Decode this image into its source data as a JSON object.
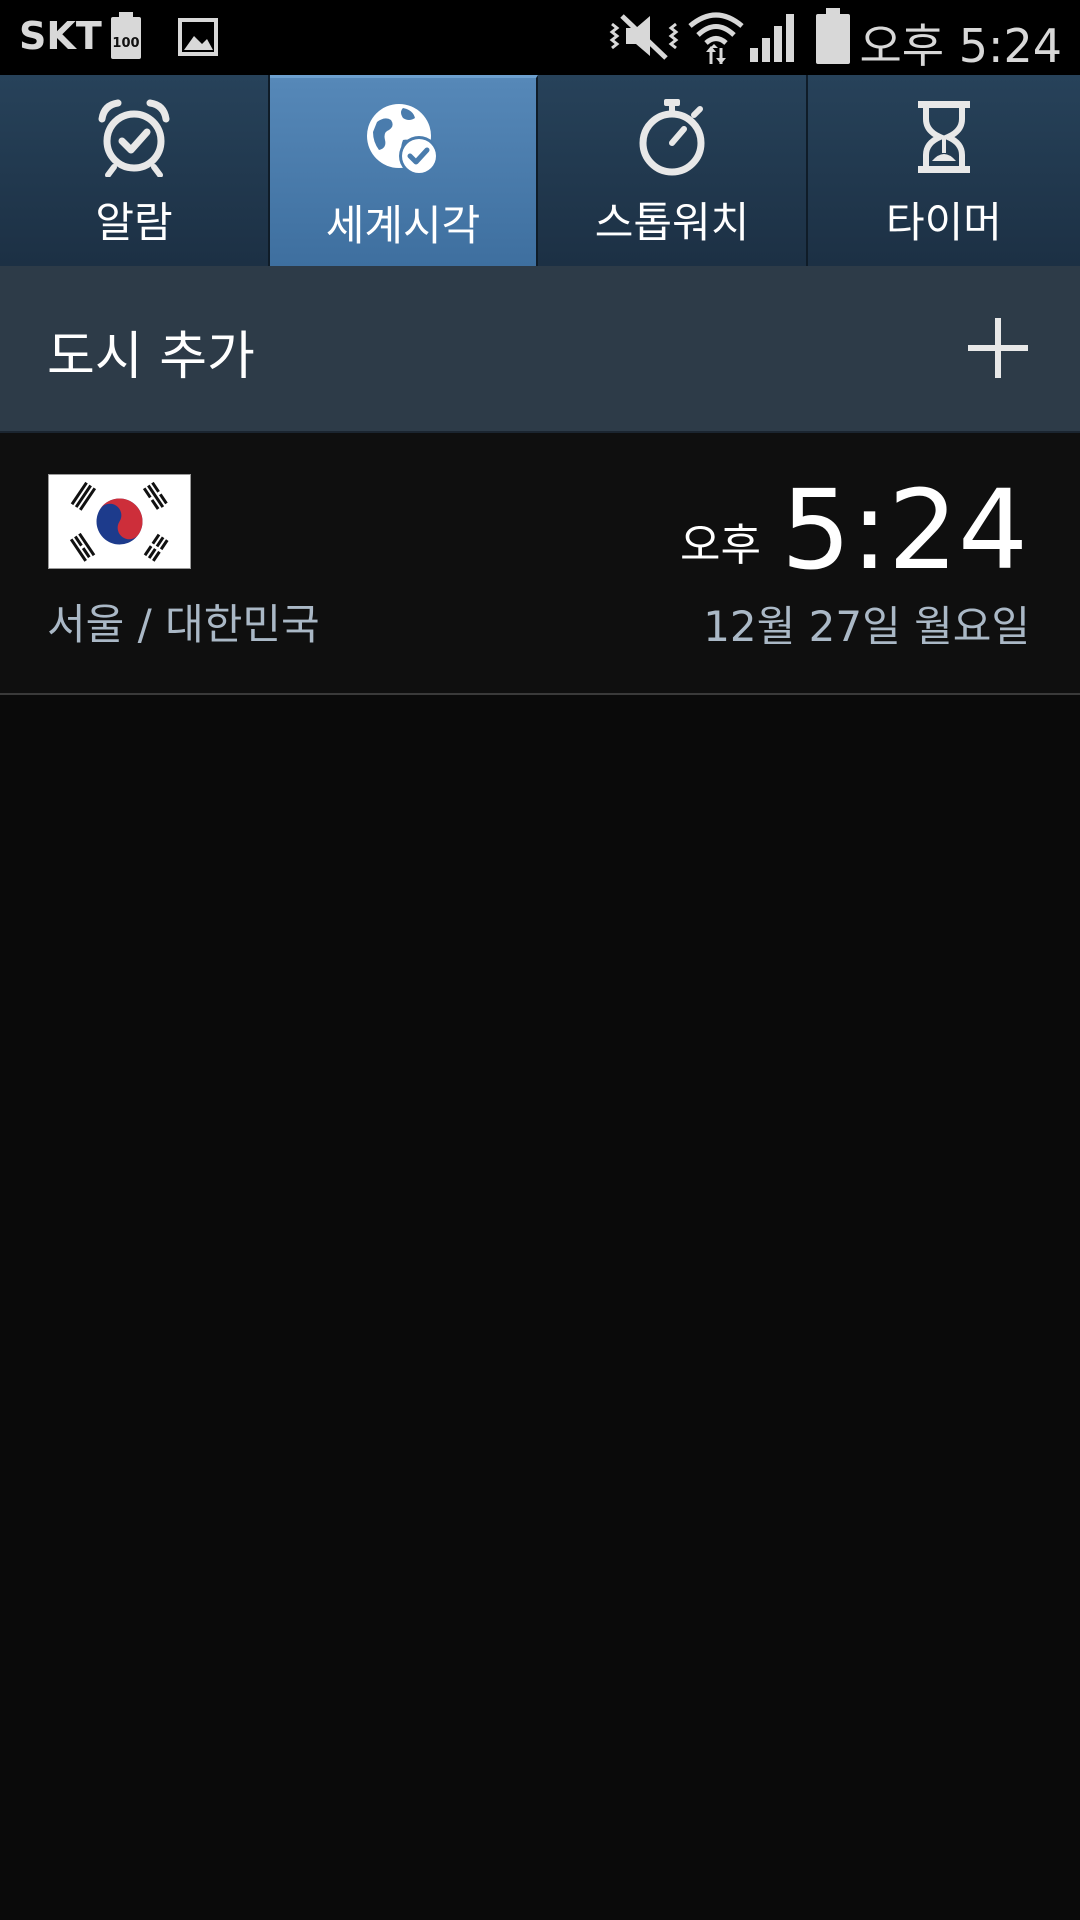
{
  "status_bar": {
    "carrier": "SKT",
    "battery_badge": "100",
    "time": "오후 5:24",
    "icons": [
      "battery-100-icon",
      "gallery-image-icon",
      "vibrate-mute-icon",
      "wifi-icon",
      "signal-icon",
      "battery-icon"
    ]
  },
  "tabs": [
    {
      "label": "알람",
      "icon": "alarm-clock-icon",
      "active": false
    },
    {
      "label": "세계시각",
      "icon": "world-clock-icon",
      "active": true
    },
    {
      "label": "스톱워치",
      "icon": "stopwatch-icon",
      "active": false
    },
    {
      "label": "타이머",
      "icon": "hourglass-icon",
      "active": false
    }
  ],
  "add_city": {
    "label": "도시 추가",
    "icon": "plus-icon"
  },
  "cities": [
    {
      "flag": "south-korea-flag",
      "name": "서울 / 대한민국",
      "ampm": "오후",
      "time": "5:24",
      "date": "12월 27일 월요일"
    }
  ],
  "colors": {
    "tab_inactive": "#223a50",
    "tab_active": "#4a7cad",
    "add_row": "#2d3b48",
    "background": "#0a0a0a",
    "secondary_text": "#aab8c6"
  }
}
